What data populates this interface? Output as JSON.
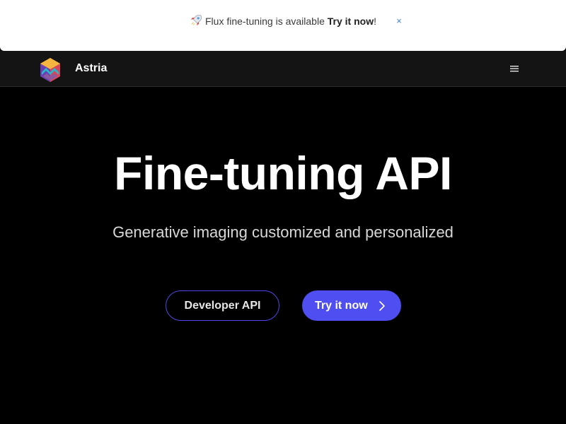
{
  "banner": {
    "message": "Flux fine-tuning is available",
    "cta": "Try it now",
    "suffix": "!",
    "close_label": "×"
  },
  "navbar": {
    "brand": "Astria",
    "menu_icon": "hamburger-menu-icon",
    "logo_icon": "astria-logo"
  },
  "hero": {
    "title": "Fine-tuning API",
    "subtitle": "Generative imaging customized and personalized",
    "buttons": {
      "developer_api": "Developer API",
      "try_it_now": "Try it now"
    }
  },
  "colors": {
    "background": "#000000",
    "navbar": "#141414",
    "accent": "#4f4ef0",
    "close_icon": "#3b82f6"
  }
}
